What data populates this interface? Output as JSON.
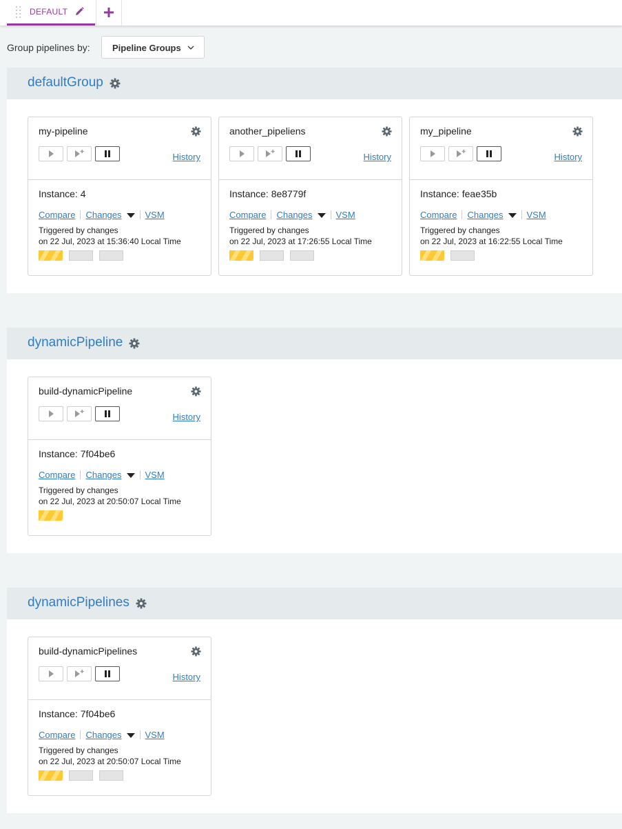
{
  "tabs": [
    {
      "label": "DEFAULT",
      "active": true
    }
  ],
  "group_by": {
    "label": "Group pipelines by:",
    "selected": "Pipeline Groups"
  },
  "colors": {
    "accent": "#943a9e",
    "link": "#2f7dc4",
    "building": "#ffc933",
    "unknown": "#e4e4e4"
  },
  "groups": [
    {
      "name": "defaultGroup",
      "pipelines": [
        {
          "name": "my-pipeline",
          "history": "History",
          "instance": "Instance: 4",
          "compare": "Compare",
          "changes": "Changes",
          "vsm": "VSM",
          "triggered_by": "Triggered by changes",
          "triggered_on": "on 22 Jul, 2023 at 15:36:40 Local Time",
          "stages": [
            "building",
            "unknown",
            "unknown"
          ]
        },
        {
          "name": "another_pipeliens",
          "history": "History",
          "instance": "Instance: 8e8779f",
          "compare": "Compare",
          "changes": "Changes",
          "vsm": "VSM",
          "triggered_by": "Triggered by changes",
          "triggered_on": "on 22 Jul, 2023 at 17:26:55 Local Time",
          "stages": [
            "building",
            "unknown",
            "unknown"
          ]
        },
        {
          "name": "my_pipeline",
          "history": "History",
          "instance": "Instance: feae35b",
          "compare": "Compare",
          "changes": "Changes",
          "vsm": "VSM",
          "triggered_by": "Triggered by changes",
          "triggered_on": "on 22 Jul, 2023 at 16:22:55 Local Time",
          "stages": [
            "building",
            "unknown"
          ]
        }
      ]
    },
    {
      "name": "dynamicPipeline",
      "pipelines": [
        {
          "name": "build-dynamicPipeline",
          "history": "History",
          "instance": "Instance: 7f04be6",
          "compare": "Compare",
          "changes": "Changes",
          "vsm": "VSM",
          "triggered_by": "Triggered by changes",
          "triggered_on": "on 22 Jul, 2023 at 20:50:07 Local Time",
          "stages": [
            "building"
          ]
        }
      ]
    },
    {
      "name": "dynamicPipelines",
      "pipelines": [
        {
          "name": "build-dynamicPipelines",
          "history": "History",
          "instance": "Instance: 7f04be6",
          "compare": "Compare",
          "changes": "Changes",
          "vsm": "VSM",
          "triggered_by": "Triggered by changes",
          "triggered_on": "on 22 Jul, 2023 at 20:50:07 Local Time",
          "stages": [
            "building",
            "unknown",
            "unknown"
          ]
        }
      ]
    }
  ]
}
